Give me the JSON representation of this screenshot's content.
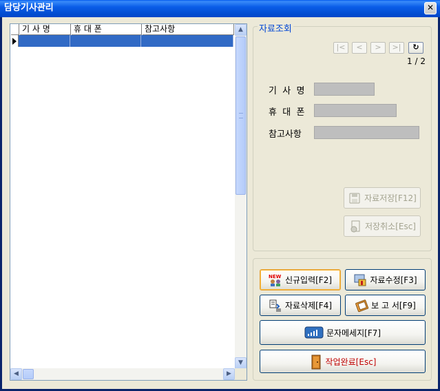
{
  "window": {
    "title": "담당기사관리",
    "close_glyph": "✕"
  },
  "grid": {
    "columns": [
      "기 사 명",
      "휴 대 폰",
      "참고사항"
    ],
    "rows": [
      {
        "name": "",
        "phone": "",
        "note": ""
      }
    ]
  },
  "detail": {
    "group_title": "자료조회",
    "pager": "1 / 2",
    "nav": {
      "first": "|<",
      "prev": "<",
      "next": ">",
      "last": ">|",
      "refresh": "↻"
    },
    "labels": {
      "name": "기  사  명",
      "phone": "휴  대  폰",
      "note": "참고사항"
    },
    "values": {
      "name": "",
      "phone": "",
      "note": ""
    },
    "save_label": "자료저장[F12]",
    "cancel_label": "저장취소[Esc]"
  },
  "actions": {
    "new_label": "신규입력[F2]",
    "new_badge": "NEW",
    "edit_label": "자료수정[F3]",
    "delete_label": "자료삭제[F4]",
    "report_label": "보 고 서[F9]",
    "sms_label": "문자메세지[F7]",
    "done_label": "작업완료[Esc]"
  },
  "colors": {
    "selection": "#316AC5",
    "title_bar": "#0A5DE8",
    "group_title": "#0046D5",
    "done_text": "#C00000"
  }
}
